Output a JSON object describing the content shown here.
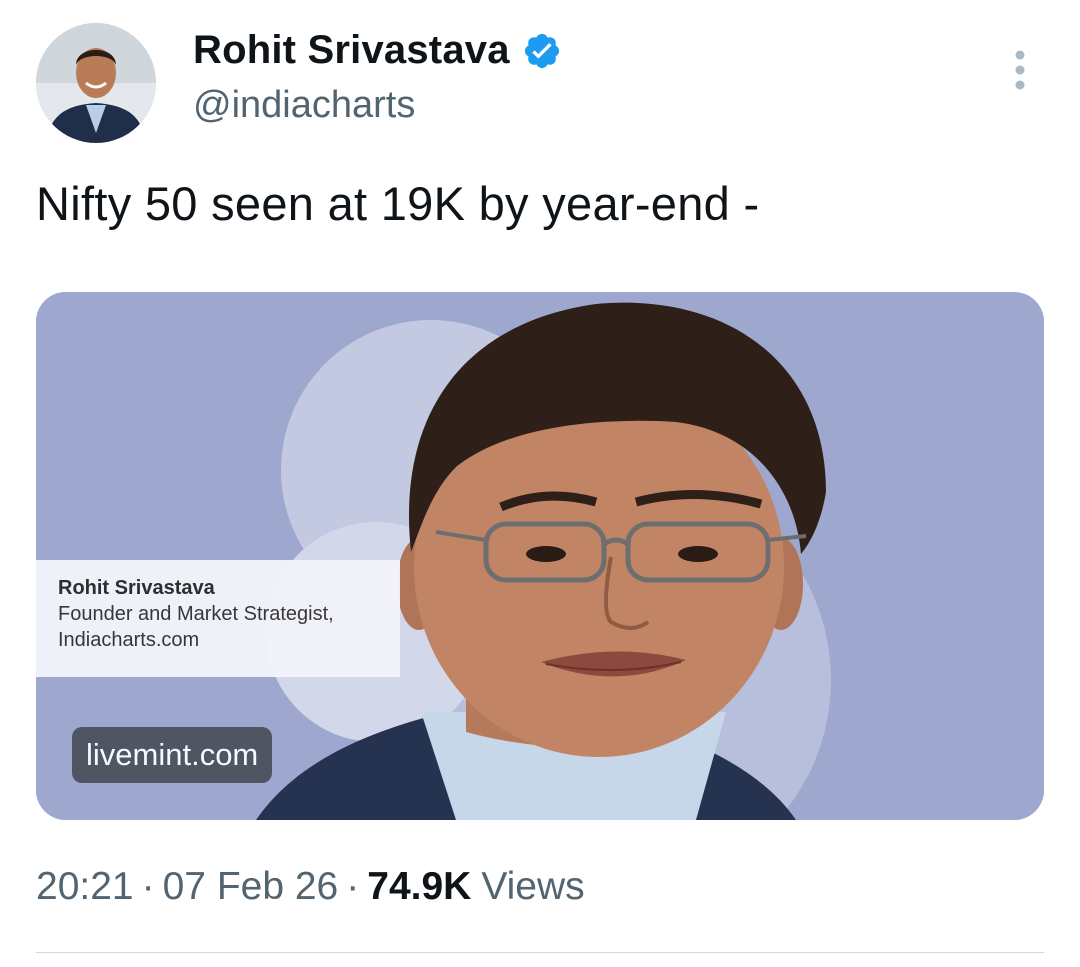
{
  "author": {
    "name": "Rohit Srivastava",
    "handle": "@indiacharts",
    "verified": true,
    "avatar_icon": "profile-photo",
    "verified_icon": "verified-badge-icon",
    "verified_color": "#1d9bf0"
  },
  "tweet": {
    "text": "Nifty 50 seen at 19K by year-end -"
  },
  "card": {
    "background_color": "#9ea8cf",
    "caption": {
      "name": "Rohit Srivastava",
      "role": "Founder and Market Strategist,",
      "site": "Indiacharts.com"
    },
    "source": "livemint.com"
  },
  "meta": {
    "time": "20:21",
    "separator": "·",
    "date": "07 Feb 26",
    "views_count": "74.9K",
    "views_label": "Views"
  },
  "icons": {
    "more": "more-vertical-icon"
  }
}
